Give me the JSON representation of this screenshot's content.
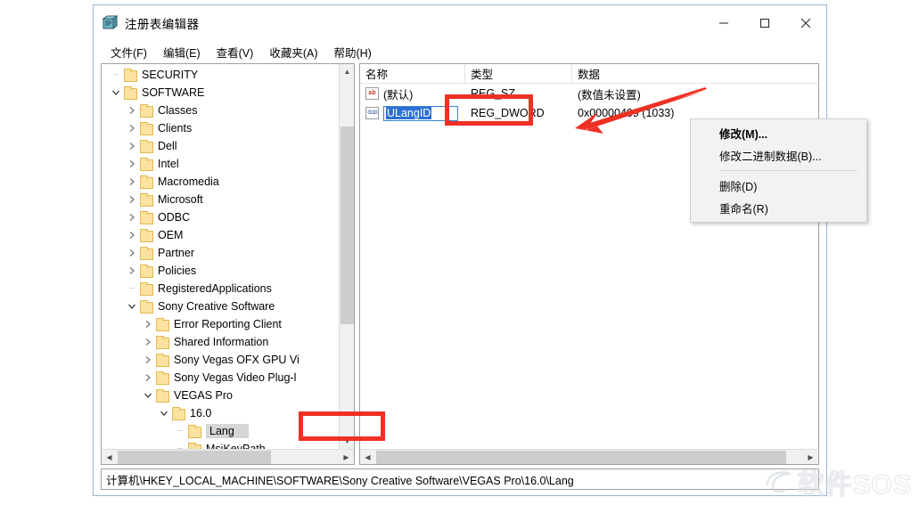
{
  "window": {
    "title": "注册表编辑器",
    "icon": "registry-editor-icon",
    "controls": {
      "minimize": "—",
      "maximize": "□",
      "close": "✕"
    }
  },
  "menu": [
    {
      "label": "文件(F)"
    },
    {
      "label": "编辑(E)"
    },
    {
      "label": "查看(V)"
    },
    {
      "label": "收藏夹(A)"
    },
    {
      "label": "帮助(H)"
    }
  ],
  "tree": [
    {
      "label": "SECURITY",
      "indent": 1,
      "twisty": "none"
    },
    {
      "label": "SOFTWARE",
      "indent": 1,
      "twisty": "open"
    },
    {
      "label": "Classes",
      "indent": 2,
      "twisty": "closed"
    },
    {
      "label": "Clients",
      "indent": 2,
      "twisty": "closed"
    },
    {
      "label": "Dell",
      "indent": 2,
      "twisty": "closed"
    },
    {
      "label": "Intel",
      "indent": 2,
      "twisty": "closed"
    },
    {
      "label": "Macromedia",
      "indent": 2,
      "twisty": "closed"
    },
    {
      "label": "Microsoft",
      "indent": 2,
      "twisty": "closed"
    },
    {
      "label": "ODBC",
      "indent": 2,
      "twisty": "closed"
    },
    {
      "label": "OEM",
      "indent": 2,
      "twisty": "closed"
    },
    {
      "label": "Partner",
      "indent": 2,
      "twisty": "closed"
    },
    {
      "label": "Policies",
      "indent": 2,
      "twisty": "closed"
    },
    {
      "label": "RegisteredApplications",
      "indent": 2,
      "twisty": "none"
    },
    {
      "label": "Sony Creative Software",
      "indent": 2,
      "twisty": "open"
    },
    {
      "label": "Error Reporting Client",
      "indent": 3,
      "twisty": "closed"
    },
    {
      "label": "Shared Information",
      "indent": 3,
      "twisty": "closed"
    },
    {
      "label": "Sony Vegas OFX GPU Vi",
      "indent": 3,
      "twisty": "closed"
    },
    {
      "label": "Sony Vegas Video Plug-l",
      "indent": 3,
      "twisty": "closed"
    },
    {
      "label": "VEGAS Pro",
      "indent": 3,
      "twisty": "open"
    },
    {
      "label": "16.0",
      "indent": 4,
      "twisty": "open"
    },
    {
      "label": "Lang",
      "indent": 5,
      "twisty": "none",
      "selected": true
    },
    {
      "label": "MsiKeyPath",
      "indent": 5,
      "twisty": "none"
    }
  ],
  "list": {
    "columns": [
      "名称",
      "类型",
      "数据"
    ],
    "rows": [
      {
        "icon": "string-value-icon",
        "icon_glyph": "ab",
        "name": "(默认)",
        "type": "REG_SZ",
        "data": "(数值未设置)",
        "editing": false
      },
      {
        "icon": "binary-value-icon",
        "icon_glyph": "011\n100",
        "name": "ULangID",
        "type": "REG_DWORD",
        "data": "0x00000409 (1033)",
        "editing": true
      }
    ]
  },
  "context_menu": [
    {
      "label": "修改(M)...",
      "bold": true
    },
    {
      "label": "修改二进制数据(B)...",
      "bold": false
    },
    {
      "separator": true
    },
    {
      "label": "删除(D)",
      "bold": false
    },
    {
      "label": "重命名(R)",
      "bold": false
    }
  ],
  "status": {
    "path": "计算机\\HKEY_LOCAL_MACHINE\\SOFTWARE\\Sony Creative Software\\VEGAS Pro\\16.0\\Lang"
  },
  "watermark": {
    "text": "软件SOS"
  },
  "colors": {
    "annotation_red": "#ef3124",
    "selection_blue": "#2a6fd4",
    "folder_yellow": "#fbe2a0",
    "window_border": "#9ab6d4"
  }
}
